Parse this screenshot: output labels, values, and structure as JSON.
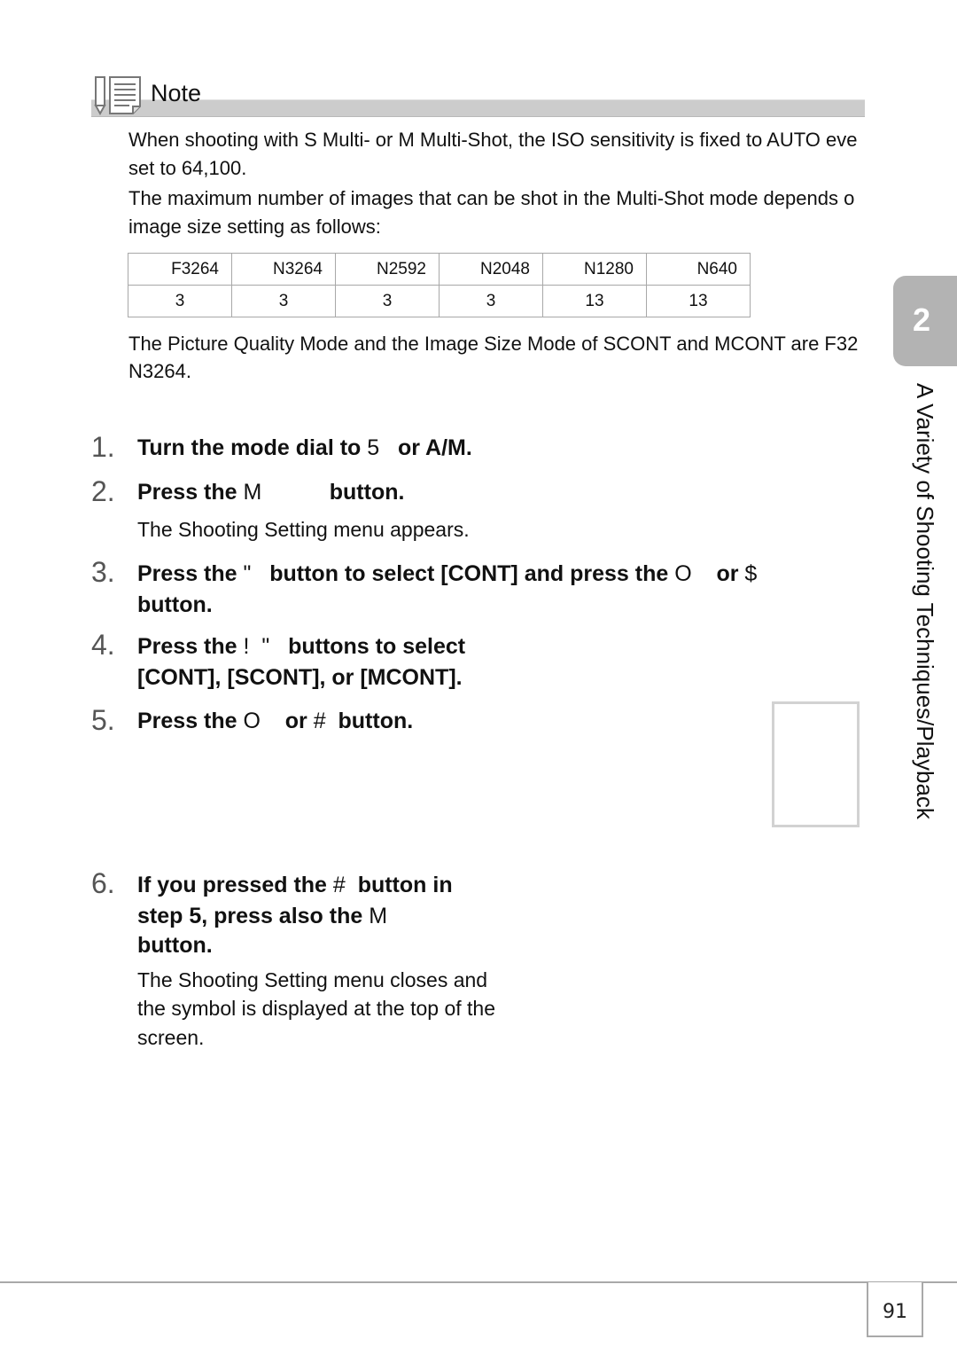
{
  "note": {
    "title": "Note",
    "icon": "note-pencil-icon",
    "paragraphs": [
      [
        "When shooting with S Multi- or M Multi-Shot, the ISO sensitivity is fixed to AUTO eve",
        "set to 64,100."
      ],
      [
        "The maximum number of images that can be shot in the Multi-Shot mode depends o",
        "image size setting as follows:"
      ]
    ],
    "table": {
      "headers": [
        "F3264",
        "N3264",
        "N2592",
        "N2048",
        "N1280",
        "N640"
      ],
      "values": [
        "3",
        "3",
        "3",
        "3",
        "13",
        "13"
      ]
    },
    "footer_paragraph": [
      "The Picture Quality Mode and the Image Size Mode of SCONT and MCONT are F32",
      "N3264."
    ]
  },
  "steps": [
    {
      "num": "1.",
      "lines": [
        [
          "Turn the mode dial to ",
          "5",
          "   or A/M."
        ]
      ]
    },
    {
      "num": "2.",
      "lines": [
        [
          "Press the ",
          "M",
          "           button."
        ]
      ],
      "note": [
        "The Shooting Setting menu appears."
      ]
    },
    {
      "num": "3.",
      "lines": [
        [
          "Press the ",
          "\"",
          "   button to select [CONT] and press the ",
          "O",
          "    or ",
          "$"
        ],
        [
          "button.",
          "",
          ""
        ]
      ]
    },
    {
      "num": "4.",
      "lines": [
        [
          "Press the ",
          "!  \"",
          "   buttons to select"
        ],
        [
          "[CONT], [SCONT], or [MCONT].",
          "",
          ""
        ]
      ]
    },
    {
      "num": "5.",
      "lines": [
        [
          "Press the ",
          "O",
          "    or ",
          "#",
          "  button."
        ]
      ]
    },
    {
      "num": "6.",
      "lines": [
        [
          "If you pressed the ",
          "#",
          "  button in"
        ],
        [
          "step 5, press also the ",
          "M",
          ""
        ],
        [
          "button.",
          "",
          ""
        ]
      ],
      "note": [
        "The Shooting Setting menu closes and",
        "the symbol is displayed at the top of the",
        "screen."
      ]
    }
  ],
  "sidebar": {
    "chapter_number": "2",
    "chapter_title": "A Variety of Shooting Techniques/Playback"
  },
  "page_number": "91"
}
